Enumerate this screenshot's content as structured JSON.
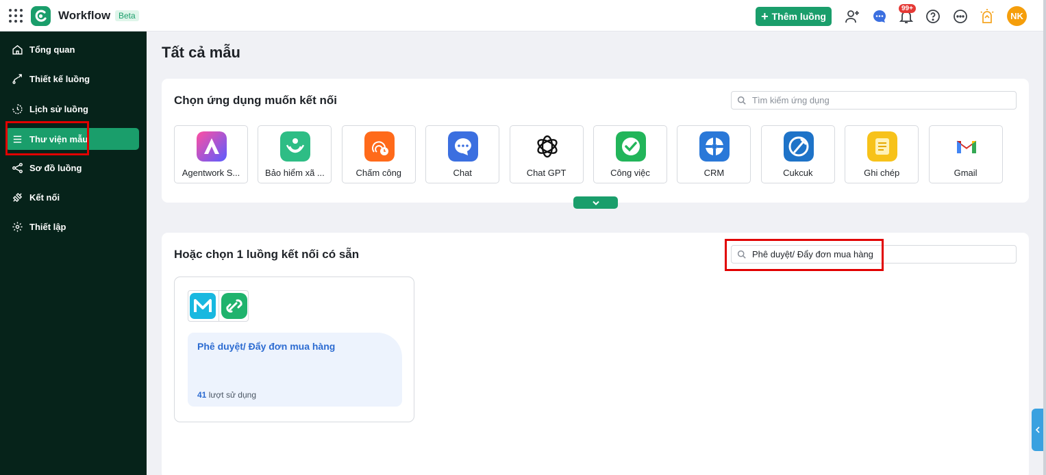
{
  "app": {
    "title": "Workflow",
    "badge": "Beta"
  },
  "header": {
    "add_flow_label": "Thêm luồng",
    "notification_count": "99+",
    "user_initials": "NK",
    "icons": [
      "apps-grid-icon",
      "add-user-icon",
      "chat-bubble-icon",
      "bell-icon",
      "help-icon",
      "more-icon",
      "lightbulb-icon"
    ]
  },
  "sidebar": {
    "items": [
      {
        "label": "Tổng quan",
        "icon": "home-icon"
      },
      {
        "label": "Thiết kế luồng",
        "icon": "flow-design-icon"
      },
      {
        "label": "Lịch sử luồng",
        "icon": "history-icon"
      },
      {
        "label": "Thư viện mẫu",
        "icon": "menu-lines-icon",
        "active": true
      },
      {
        "label": "Sơ đồ luồng",
        "icon": "diagram-icon"
      },
      {
        "label": "Kết nối",
        "icon": "connect-icon"
      },
      {
        "label": "Thiết lập",
        "icon": "gear-icon"
      }
    ]
  },
  "main": {
    "page_title": "Tất cả mẫu",
    "apps_section": {
      "title": "Chọn ứng dụng muốn kết nối",
      "search_placeholder": "Tìm kiếm ứng dụng",
      "apps": [
        {
          "label": "Agentwork S...",
          "icon": "agentwork-icon",
          "color": "#7c4dff"
        },
        {
          "label": "Bảo hiểm xã ...",
          "icon": "insurance-icon",
          "color": "#2ebd85"
        },
        {
          "label": "Chấm công",
          "icon": "timekeeping-icon",
          "color": "#ff6a1a"
        },
        {
          "label": "Chat",
          "icon": "chat-app-icon",
          "color": "#3b6fe0"
        },
        {
          "label": "Chat GPT",
          "icon": "chatgpt-icon",
          "color": "#111111"
        },
        {
          "label": "Công việc",
          "icon": "task-icon",
          "color": "#22b55a"
        },
        {
          "label": "CRM",
          "icon": "crm-icon",
          "color": "#2a78d8"
        },
        {
          "label": "Cukcuk",
          "icon": "cukcuk-icon",
          "color": "#1e73c8"
        },
        {
          "label": "Ghi chép",
          "icon": "notes-icon",
          "color": "#f7c21a"
        },
        {
          "label": "Gmail",
          "icon": "gmail-icon",
          "color": "#ea4335"
        }
      ]
    },
    "flows_section": {
      "title": "Hoặc chọn 1 luồng kết nối có sẵn",
      "search_value": "Phê duyệt/ Đẩy đơn mua hàng",
      "flows": [
        {
          "title": "Phê duyệt/ Đẩy đơn mua hàng",
          "usage_count": "41",
          "usage_suffix": "lượt sử dụng"
        }
      ]
    }
  },
  "colors": {
    "accent": "#1a9e6b",
    "sidebar_bg": "#06231a",
    "link_blue": "#2c6bd1",
    "highlight_red": "#e10000"
  }
}
